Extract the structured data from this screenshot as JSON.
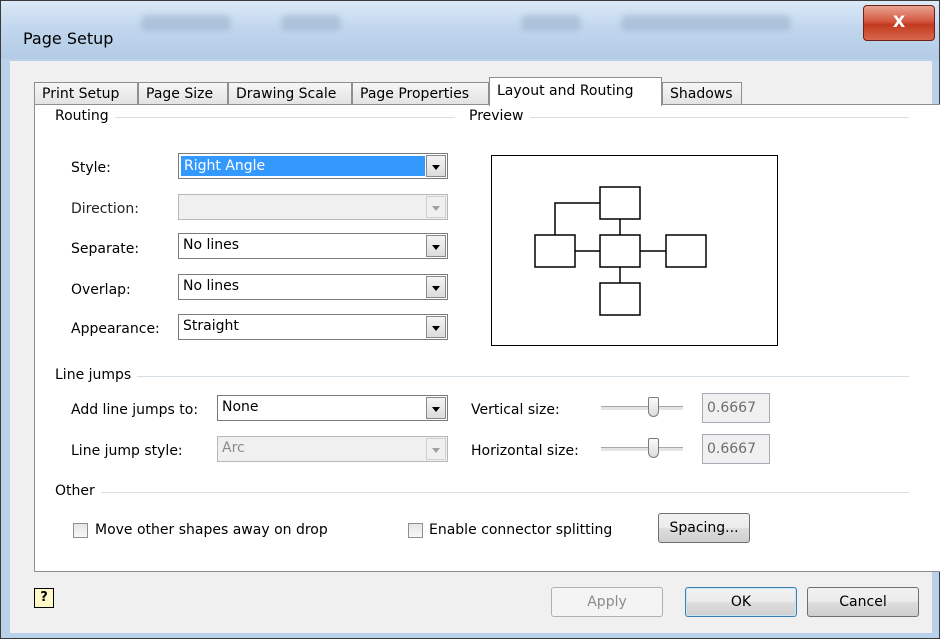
{
  "window": {
    "title": "Page Setup",
    "close_glyph": "X"
  },
  "tabs": [
    {
      "label": "Print Setup"
    },
    {
      "label": "Page Size"
    },
    {
      "label": "Drawing Scale"
    },
    {
      "label": "Page Properties"
    },
    {
      "label": "Layout and Routing",
      "active": true
    },
    {
      "label": "Shadows"
    }
  ],
  "routing": {
    "group_label": "Routing",
    "style": {
      "label": "Style:",
      "value": "Right Angle",
      "selected": true
    },
    "direction": {
      "label": "Direction:",
      "value": "",
      "disabled": true
    },
    "separate": {
      "label": "Separate:",
      "value": "No lines"
    },
    "overlap": {
      "label": "Overlap:",
      "value": "No lines"
    },
    "appearance": {
      "label": "Appearance:",
      "value": "Straight"
    }
  },
  "preview": {
    "group_label": "Preview"
  },
  "line_jumps": {
    "group_label": "Line jumps",
    "add_to": {
      "label": "Add line jumps to:",
      "value": "None"
    },
    "style": {
      "label": "Line jump style:",
      "value": "Arc",
      "disabled": true
    },
    "vertical_size": {
      "label": "Vertical size:",
      "value": "0.6667",
      "slider_fraction": 0.68
    },
    "horizontal_size": {
      "label": "Horizontal size:",
      "value": "0.6667",
      "slider_fraction": 0.68
    }
  },
  "other": {
    "group_label": "Other",
    "move_shapes": {
      "label": "Move other shapes away on drop",
      "checked": false
    },
    "connector_splitting": {
      "label": "Enable connector splitting",
      "checked": false
    },
    "spacing_button": "Spacing..."
  },
  "footer": {
    "help_glyph": "?",
    "apply": "Apply",
    "ok": "OK",
    "cancel": "Cancel"
  },
  "icons": [
    "help-icon",
    "close-icon",
    "dropdown-arrow-icon"
  ]
}
